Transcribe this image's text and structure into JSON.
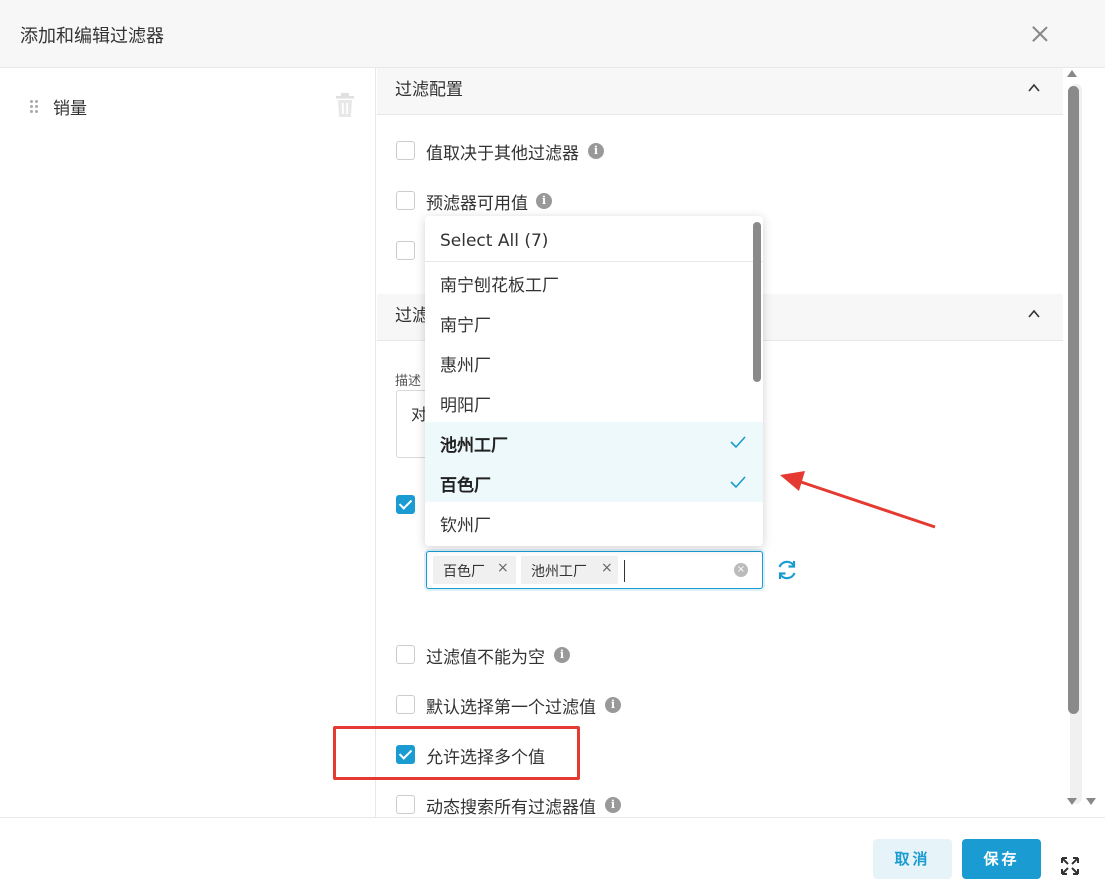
{
  "modal": {
    "title": "添加和编辑过滤器"
  },
  "sidebar": {
    "items": [
      {
        "label": "销量"
      }
    ]
  },
  "filter_config": {
    "section_title": "过滤配置",
    "options": [
      {
        "label": "值取决于其他过滤器",
        "checked": false,
        "info": "i"
      },
      {
        "label": "预滤器可用值",
        "checked": false,
        "info": "i"
      }
    ]
  },
  "filter_settings": {
    "section_title_partial": "过滤",
    "description_label_partial": "描述",
    "description_value_partial": "对"
  },
  "dropdown": {
    "select_all_label": "Select All (7)",
    "options": [
      {
        "label": "南宁刨花板工厂",
        "selected": false
      },
      {
        "label": "南宁厂",
        "selected": false
      },
      {
        "label": "惠州厂",
        "selected": false
      },
      {
        "label": "明阳厂",
        "selected": false
      },
      {
        "label": "池州工厂",
        "selected": true
      },
      {
        "label": "百色厂",
        "selected": true
      },
      {
        "label": "钦州厂",
        "selected": false
      }
    ]
  },
  "default_value": {
    "tags": [
      {
        "label": "百色厂",
        "remove": "×"
      },
      {
        "label": "池州工厂",
        "remove": "×"
      }
    ],
    "clear_label": "×"
  },
  "more_options": [
    {
      "label": "过滤值不能为空",
      "checked": false,
      "info": "i"
    },
    {
      "label": "默认选择第一个过滤值",
      "checked": false,
      "info": "i"
    },
    {
      "label": "允许选择多个值",
      "checked": true
    },
    {
      "label": "动态搜索所有过滤器值",
      "checked": false,
      "info": "i"
    }
  ],
  "footer": {
    "cancel_label": "取消",
    "save_label": "保存"
  },
  "colors": {
    "accent": "#1a9bd1",
    "annotation_red": "#e43a32"
  }
}
